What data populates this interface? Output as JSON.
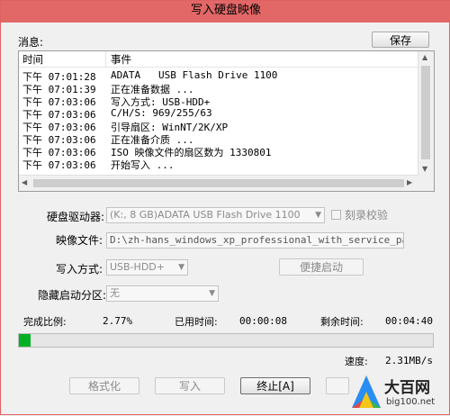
{
  "window": {
    "title": "写入硬盘映像"
  },
  "messages": {
    "label": "消息:",
    "save_label": "保存",
    "columns": {
      "time": "时间",
      "event": "事件"
    },
    "rows": [
      {
        "time": "下午 07:01:28",
        "event": "ADATA   USB Flash Drive 1100"
      },
      {
        "time": "下午 07:01:39",
        "event": "正在准备数据 ..."
      },
      {
        "time": "下午 07:03:06",
        "event": "写入方式: USB-HDD+"
      },
      {
        "time": "下午 07:03:06",
        "event": "C/H/S: 969/255/63"
      },
      {
        "time": "下午 07:03:06",
        "event": "引导扇区: WinNT/2K/XP"
      },
      {
        "time": "下午 07:03:06",
        "event": "正在准备介质 ..."
      },
      {
        "time": "下午 07:03:06",
        "event": "ISO 映像文件的扇区数为 1330801"
      },
      {
        "time": "下午 07:03:06",
        "event": "开始写入 ..."
      }
    ]
  },
  "form": {
    "drive_label": "硬盘驱动器:",
    "drive_value": "(K:, 8 GB)ADATA   USB Flash Drive 1100",
    "verify_label": "刻录校验",
    "image_label": "映像文件:",
    "image_value": "D:\\zh-hans_windows_xp_professional_with_service_pack_3_x86_",
    "method_label": "写入方式:",
    "method_value": "USB-HDD+",
    "convenient_boot_label": "便捷启动",
    "hidden_partition_label": "隐藏启动分区:",
    "hidden_partition_value": "无"
  },
  "progress": {
    "done_label": "完成比例:",
    "done_value": "2.77%",
    "fraction": 0.0277,
    "elapsed_label": "已用时间:",
    "elapsed_value": "00:00:08",
    "remaining_label": "剩余时间:",
    "remaining_value": "00:04:40",
    "speed_label": "速度:",
    "speed_value": "2.31MB/s"
  },
  "buttons": {
    "format": "格式化",
    "write": "写入",
    "stop": "终止[A]"
  },
  "watermark": {
    "brand": "大百网",
    "site": "big100.net"
  },
  "colors": {
    "titlebar": "#e26767",
    "progress": "#06b025"
  }
}
